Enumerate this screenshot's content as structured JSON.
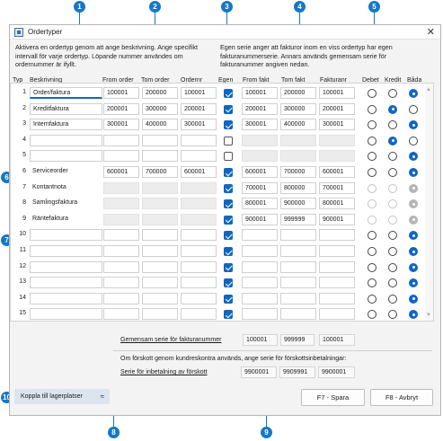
{
  "callouts": [
    "1",
    "2",
    "3",
    "4",
    "5",
    "6",
    "7",
    "8",
    "9",
    "10"
  ],
  "window": {
    "title": "Ordertyper",
    "close": "✕"
  },
  "desc_left": "Aktivera en ordertyp genom att ange beskrivning. Ange specifikt intervall för varje ordertyp. Löpande nummer användes om ordernummer är ifyllt.",
  "desc_right": "Egen serie anger att fakturor inom en viss ordertyp har egen fakturanummerserie. Annars används gemensam serie för fakturanummer angiven nedan.",
  "headers": {
    "typ": "Typ",
    "beskrivning": "Beskrivning",
    "from_order": "From order",
    "tom_order": "Tom order",
    "ordernr": "Ordernr",
    "egen": "Egen",
    "from_fakt": "From fakt",
    "tom_fakt": "Tom fakt",
    "fakturanr": "Fakturanr",
    "debet": "Debet",
    "kredit": "Kredit",
    "bada": "Båda"
  },
  "rows": [
    {
      "n": "1",
      "desc": "Order/faktura",
      "from": "100001",
      "tom": "200000",
      "ordernr": "100001",
      "egen": true,
      "ffrom": "100001",
      "ftom": "200000",
      "fnr": "100001",
      "radio": "bada",
      "mode": "edit",
      "focus": true
    },
    {
      "n": "2",
      "desc": "Kreditfaktura",
      "from": "200001",
      "tom": "300000",
      "ordernr": "200001",
      "egen": true,
      "ffrom": "200001",
      "ftom": "300000",
      "fnr": "200001",
      "radio": "kredit",
      "mode": "edit"
    },
    {
      "n": "3",
      "desc": "Internfaktura",
      "from": "300001",
      "tom": "400000",
      "ordernr": "300001",
      "egen": true,
      "ffrom": "300001",
      "ftom": "400000",
      "fnr": "300001",
      "radio": "bada",
      "mode": "edit"
    },
    {
      "n": "4",
      "desc": "",
      "from": "",
      "tom": "",
      "ordernr": "",
      "egen": false,
      "ffrom": "",
      "ftom": "",
      "fnr": "",
      "radio": "kredit",
      "mode": "edit"
    },
    {
      "n": "5",
      "desc": "",
      "from": "",
      "tom": "",
      "ordernr": "",
      "egen": false,
      "ffrom": "",
      "ftom": "",
      "fnr": "",
      "radio": "bada",
      "mode": "edit"
    },
    {
      "n": "6",
      "desc": "Serviceorder",
      "from": "600001",
      "tom": "700000",
      "ordernr": "600001",
      "egen": true,
      "ffrom": "600001",
      "ftom": "700000",
      "fnr": "600001",
      "radio": "bada",
      "mode": "static"
    },
    {
      "n": "7",
      "desc": "Kontantnota",
      "from": "",
      "tom": "",
      "ordernr": "",
      "egen": true,
      "ffrom": "700001",
      "ftom": "800000",
      "fnr": "700001",
      "radio": "bada",
      "mode": "disabled"
    },
    {
      "n": "8",
      "desc": "Samlingsfaktura",
      "from": "",
      "tom": "",
      "ordernr": "",
      "egen": true,
      "ffrom": "800001",
      "ftom": "900000",
      "fnr": "800001",
      "radio": "bada",
      "mode": "disabled"
    },
    {
      "n": "9",
      "desc": "Räntefaktura",
      "from": "",
      "tom": "",
      "ordernr": "",
      "egen": true,
      "ffrom": "900001",
      "ftom": "999999",
      "fnr": "900001",
      "radio": "bada",
      "mode": "disabled"
    },
    {
      "n": "10",
      "desc": "",
      "from": "",
      "tom": "",
      "ordernr": "",
      "egen": true,
      "ffrom": "",
      "ftom": "",
      "fnr": "",
      "radio": "bada",
      "mode": "edit"
    },
    {
      "n": "11",
      "desc": "",
      "from": "",
      "tom": "",
      "ordernr": "",
      "egen": true,
      "ffrom": "",
      "ftom": "",
      "fnr": "",
      "radio": "bada",
      "mode": "edit"
    },
    {
      "n": "12",
      "desc": "",
      "from": "",
      "tom": "",
      "ordernr": "",
      "egen": true,
      "ffrom": "",
      "ftom": "",
      "fnr": "",
      "radio": "bada",
      "mode": "edit"
    },
    {
      "n": "13",
      "desc": "",
      "from": "",
      "tom": "",
      "ordernr": "",
      "egen": true,
      "ffrom": "",
      "ftom": "",
      "fnr": "",
      "radio": "bada",
      "mode": "edit"
    },
    {
      "n": "14",
      "desc": "",
      "from": "",
      "tom": "",
      "ordernr": "",
      "egen": true,
      "ffrom": "",
      "ftom": "",
      "fnr": "",
      "radio": "bada",
      "mode": "edit"
    },
    {
      "n": "15",
      "desc": "",
      "from": "",
      "tom": "",
      "ordernr": "",
      "egen": true,
      "ffrom": "",
      "ftom": "",
      "fnr": "",
      "radio": "bada",
      "mode": "edit"
    }
  ],
  "scroll": {
    "up": "▲",
    "down": "▼"
  },
  "gemensam": {
    "label": "Gemensam serie för fakturanummer",
    "from": "100001",
    "tom": "999999",
    "nr": "100001"
  },
  "forskott": {
    "info": "Om förskott genom kundreskontra används, ange serie för förskottsinbetalningar:",
    "label": "Serie för inbetalning av förskott",
    "from": "9900001",
    "tom": "9909991",
    "nr": "9900001"
  },
  "buttons": {
    "lager": "Koppla till lagerplatser",
    "lager_icon": "≈",
    "save": "F7 - Spara",
    "cancel": "F8 - Avbryt"
  }
}
